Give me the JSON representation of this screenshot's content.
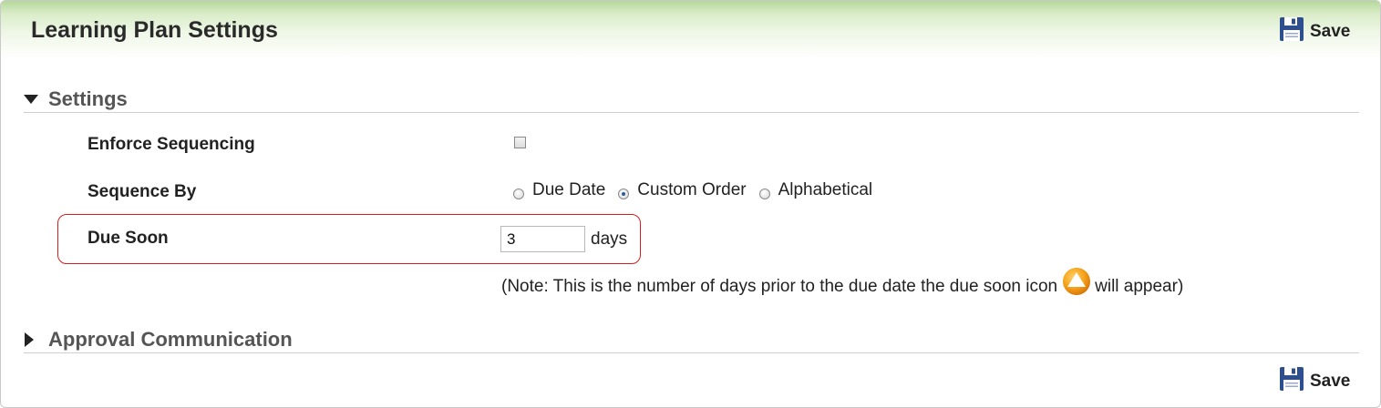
{
  "header": {
    "title": "Learning Plan Settings",
    "save_label": "Save"
  },
  "sections": {
    "settings": {
      "label": "Settings",
      "expanded": true
    },
    "approval": {
      "label": "Approval Communication",
      "expanded": false
    }
  },
  "fields": {
    "enforce_sequencing": {
      "label": "Enforce Sequencing",
      "checked": false
    },
    "sequence_by": {
      "label": "Sequence By",
      "options": [
        "Due Date",
        "Custom Order",
        "Alphabetical"
      ],
      "selected": "Custom Order"
    },
    "due_soon": {
      "label": "Due Soon",
      "value": "3",
      "unit": "days"
    }
  },
  "note": {
    "before": "(Note: This is the number of days prior to the due date the due soon icon",
    "after": "will appear)"
  },
  "footer": {
    "save_label": "Save"
  },
  "colors": {
    "highlight": "#d81c1c",
    "header_green": "#b4d89a",
    "due_soon_icon": "#f29b13",
    "save_icon": "#2d4f8f"
  },
  "icons": {
    "save": "floppy-disk-icon",
    "section_expanded": "triangle-down-icon",
    "section_collapsed": "triangle-right-icon",
    "due_soon": "due-soon-warning-icon"
  }
}
